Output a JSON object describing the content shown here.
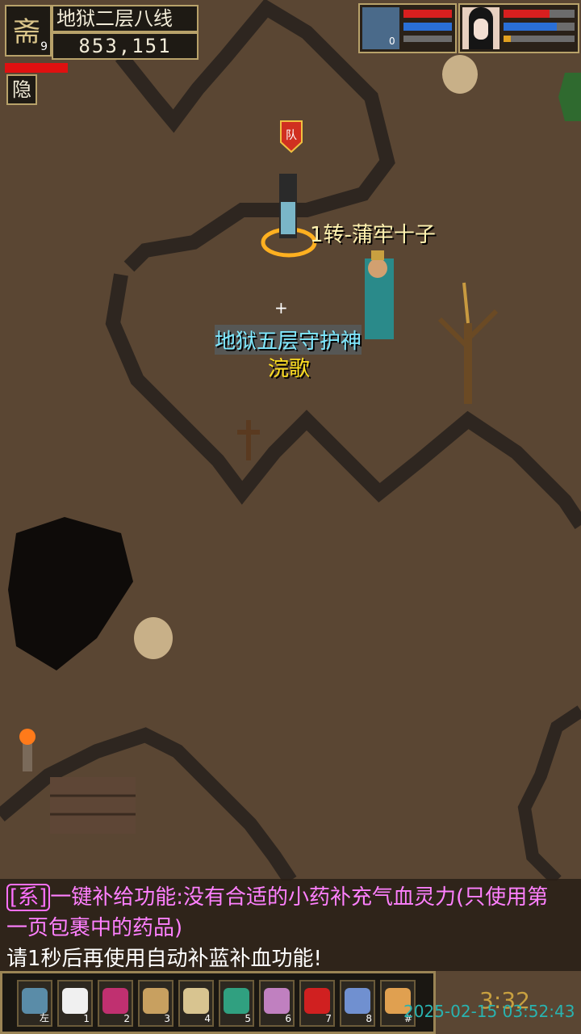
{
  "hud": {
    "level_glyph": "斋",
    "level": "9",
    "map_name": "地狱二层八线",
    "coords": "853,151",
    "hide_button": "隐"
  },
  "party": {
    "pet_level": "0",
    "pet_hp": 1.0,
    "pet_mp": 1.0,
    "player_hp": 0.65,
    "player_mp": 0.75,
    "player_exp": 0.1
  },
  "scene": {
    "player_name": "1转-蒲牢十子",
    "npc_title": "地狱五层守护神",
    "npc_name": "浣歌",
    "banner_glyph": "队"
  },
  "chat": {
    "line1_tag": "[系]",
    "line1_text": "一键补给功能:没有合适的小药补充气血灵力(只使用第",
    "line2_text": "一页包裹中的药品)",
    "line3_text": "请1秒后再使用自动补蓝补血功能!"
  },
  "hotbar": {
    "slots": [
      {
        "icon": "gear-icon",
        "key": "左",
        "color": "#5a8ca8"
      },
      {
        "icon": "chat-bubble-icon",
        "key": "1",
        "color": "#f0f0f0"
      },
      {
        "icon": "potion-icon",
        "key": "2",
        "color": "#c03070"
      },
      {
        "icon": "bag-icon",
        "key": "3",
        "color": "#c8a060"
      },
      {
        "icon": "scroll-icon",
        "key": "4",
        "color": "#d8c490"
      },
      {
        "icon": "card-icon",
        "key": "5",
        "color": "#30a080"
      },
      {
        "icon": "team-icon",
        "key": "6",
        "color": "#c080c0"
      },
      {
        "icon": "flag-icon",
        "key": "7",
        "color": "#d02020"
      },
      {
        "icon": "guild-icon",
        "key": "8",
        "color": "#7090d0"
      },
      {
        "icon": "shell-icon",
        "key": "#",
        "color": "#e0a050"
      }
    ]
  },
  "status": {
    "clock": "3:32",
    "timestamp": "2025-02-15 03:52:43"
  }
}
